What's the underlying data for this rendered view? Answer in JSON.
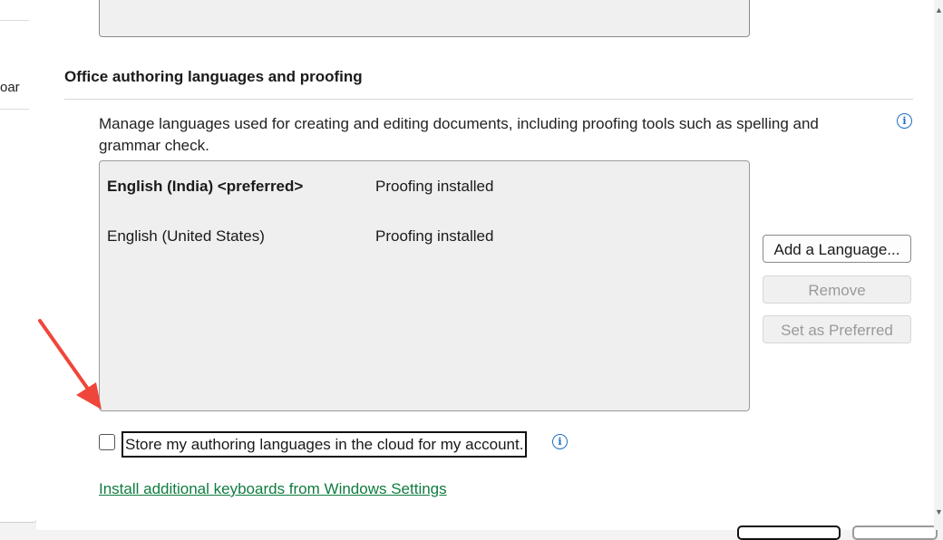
{
  "left_nav": {
    "partial_text": "oar"
  },
  "section": {
    "title": "Office authoring languages and proofing",
    "description": "Manage languages used for creating and editing documents, including proofing tools such as spelling and grammar check."
  },
  "languages": [
    {
      "name": "English (India) <preferred>",
      "status": "Proofing installed",
      "preferred": true
    },
    {
      "name": "English (United States)",
      "status": "Proofing installed",
      "preferred": false
    }
  ],
  "buttons": {
    "add_language": "Add a Language...",
    "remove": "Remove",
    "set_preferred": "Set as Preferred"
  },
  "store_cloud": {
    "label": "Store my authoring languages in the cloud for my account.",
    "checked": false
  },
  "install_link": "Install additional keyboards from Windows Settings",
  "icons": {
    "info": "info-icon",
    "annotation": "red-arrow-annotation"
  },
  "colors": {
    "link": "#107c41",
    "info": "#1e6fc9",
    "annotation_arrow": "#f0453a"
  }
}
